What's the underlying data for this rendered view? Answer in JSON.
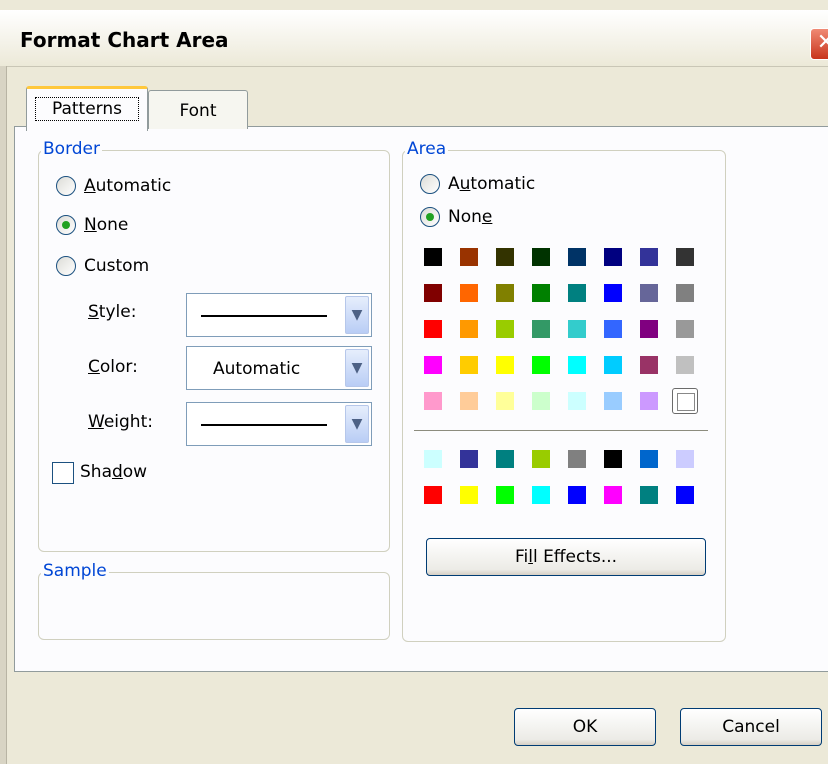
{
  "dialog": {
    "title": "Format Chart Area",
    "close_glyph": "✕"
  },
  "tabs": [
    {
      "label": "Patterns",
      "active": true
    },
    {
      "label": "Font",
      "active": false
    }
  ],
  "border": {
    "legend": "Border",
    "options": [
      {
        "pre": "",
        "key": "A",
        "post": "utomatic",
        "selected": false
      },
      {
        "pre": "",
        "key": "N",
        "post": "one",
        "selected": true
      },
      {
        "pre": "",
        "key": "",
        "post": "Custom",
        "selected": false
      }
    ],
    "style": {
      "pre": "",
      "key": "S",
      "post": "tyle:"
    },
    "color": {
      "pre": "",
      "key": "C",
      "post": "olor:",
      "value": "Automatic"
    },
    "weight": {
      "pre": "",
      "key": "W",
      "post": "eight:"
    },
    "shadow": {
      "pre": "Sha",
      "key": "d",
      "post": "ow",
      "checked": false
    }
  },
  "sample": {
    "legend": "Sample"
  },
  "area": {
    "legend": "Area",
    "options": [
      {
        "pre": "A",
        "key": "u",
        "post": "tomatic",
        "selected": false
      },
      {
        "pre": "Non",
        "key": "e",
        "post": "",
        "selected": true
      }
    ],
    "palette_main": [
      [
        "#000000",
        "#993300",
        "#333300",
        "#003300",
        "#003366",
        "#000080",
        "#333399",
        "#333333"
      ],
      [
        "#800000",
        "#ff6600",
        "#808000",
        "#008000",
        "#008080",
        "#0000ff",
        "#666699",
        "#808080"
      ],
      [
        "#ff0000",
        "#ff9900",
        "#99cc00",
        "#339966",
        "#33cccc",
        "#3366ff",
        "#800080",
        "#999999"
      ],
      [
        "#ff00ff",
        "#ffcc00",
        "#ffff00",
        "#00ff00",
        "#00ffff",
        "#00ccff",
        "#993366",
        "#c0c0c0"
      ],
      [
        "#ff99cc",
        "#ffcc99",
        "#ffff99",
        "#ccffcc",
        "#ccffff",
        "#99ccff",
        "#cc99ff",
        "#ffffff"
      ]
    ],
    "palette_chart": [
      [
        "#ccffff",
        "#333399",
        "#008080",
        "#99cc00",
        "#808080",
        "#000000",
        "#0066cc",
        "#ccccff"
      ],
      [
        "#ff0000",
        "#ffff00",
        "#00ff00",
        "#00ffff",
        "#0000ff",
        "#ff00ff",
        "#008080",
        "#0000ff"
      ]
    ],
    "selected_swatch": "4-7",
    "fill_effects": {
      "pre": "Fi",
      "key": "l",
      "post": "l Effects..."
    }
  },
  "buttons": {
    "ok": "OK",
    "cancel": "Cancel"
  }
}
